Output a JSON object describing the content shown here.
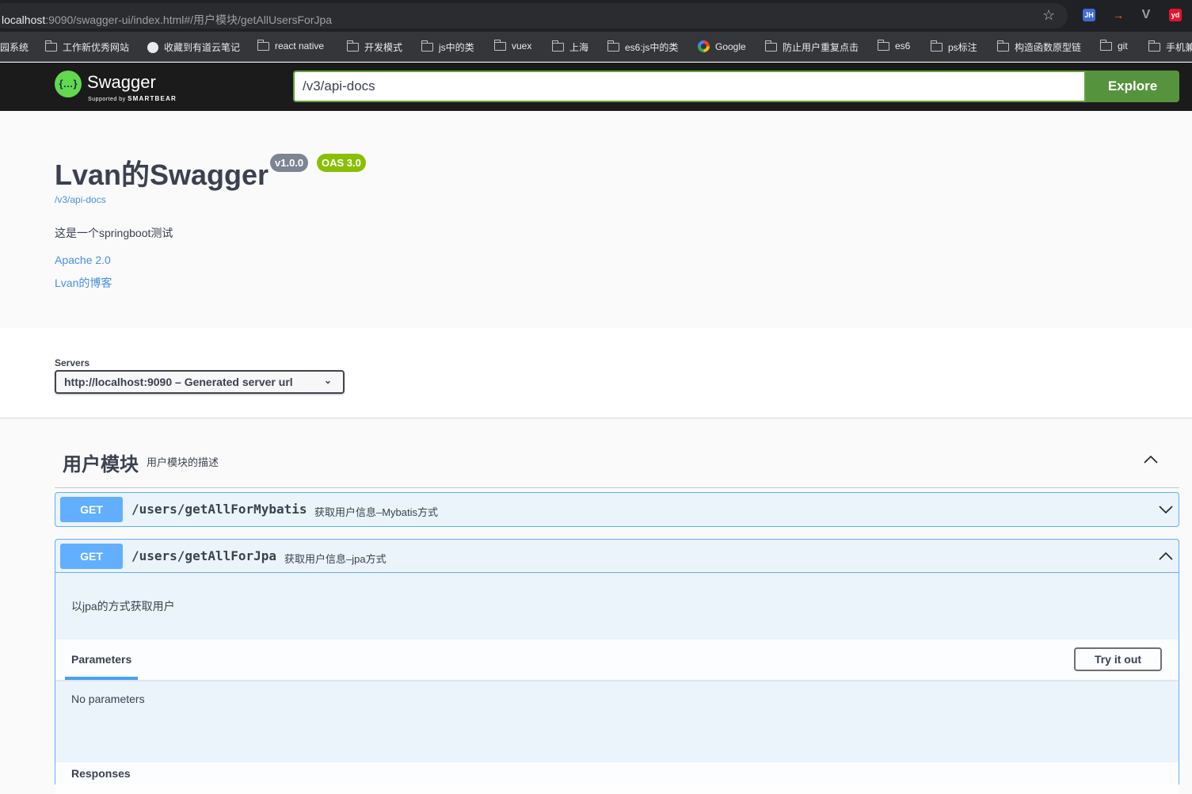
{
  "browser": {
    "url_host": "localhost",
    "url_rest": ":9090/swagger-ui/index.html#/用户模块/getAllUsersForJpa",
    "extensions": [
      "JH",
      "→",
      "V",
      "yd"
    ],
    "bookmarks": [
      {
        "label": "园系统",
        "icon": "none"
      },
      {
        "label": "工作新优秀网站",
        "icon": "folder-icon"
      },
      {
        "label": "收藏到有道云笔记",
        "icon": "globe-icon"
      },
      {
        "label": "react native",
        "icon": "folder-icon"
      },
      {
        "label": "开发模式",
        "icon": "folder-icon"
      },
      {
        "label": "js中的类",
        "icon": "folder-icon"
      },
      {
        "label": "vuex",
        "icon": "folder-icon"
      },
      {
        "label": "上海",
        "icon": "folder-icon"
      },
      {
        "label": "es6:js中的类",
        "icon": "folder-icon"
      },
      {
        "label": "Google",
        "icon": "google-icon"
      },
      {
        "label": "防止用户重复点击",
        "icon": "folder-icon"
      },
      {
        "label": "es6",
        "icon": "folder-icon"
      },
      {
        "label": "ps标注",
        "icon": "folder-icon"
      },
      {
        "label": "构造函数原型链",
        "icon": "folder-icon"
      },
      {
        "label": "git",
        "icon": "folder-icon"
      },
      {
        "label": "手机兼",
        "icon": "folder-icon"
      }
    ]
  },
  "topbar": {
    "logo_symbol": "{…}",
    "logo_text": "Swagger",
    "logo_sub_prefix": "Supported by",
    "logo_sub_brand": "SMARTBEAR",
    "url_value": "/v3/api-docs",
    "explore_label": "Explore"
  },
  "info": {
    "title": "Lvan的Swagger",
    "version_badge": "v1.0.0",
    "oas_badge": "OAS 3.0",
    "spec_link": "/v3/api-docs",
    "description": "这是一个springboot测试",
    "license_link": "Apache 2.0",
    "blog_link": "Lvan的博客"
  },
  "servers": {
    "label": "Servers",
    "selected": "http://localhost:9090 – Generated server url"
  },
  "tag": {
    "name": "用户模块",
    "description": "用户模块的描述",
    "operations": [
      {
        "method": "GET",
        "path": "/users/getAllForMybatis",
        "summary": "获取用户信息–Mybatis方式",
        "expanded": false
      },
      {
        "method": "GET",
        "path": "/users/getAllForJpa",
        "summary": "获取用户信息–jpa方式",
        "expanded": true,
        "description": "以jpa的方式获取用户",
        "parameters_tab": "Parameters",
        "try_label": "Try it out",
        "no_params": "No parameters",
        "responses_label": "Responses"
      }
    ]
  },
  "colors": {
    "get_method": "#61affe",
    "explore_green": "#55933d",
    "oas_green": "#89bf04",
    "link_blue": "#4990e2"
  }
}
